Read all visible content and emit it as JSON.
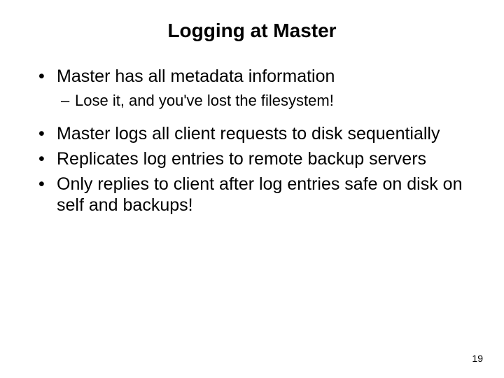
{
  "title": "Logging at Master",
  "bullets": [
    {
      "text": "Master has all metadata information",
      "subs": [
        "Lose it, and you've lost the filesystem!"
      ]
    },
    {
      "text": "Master logs all client requests to disk sequentially",
      "subs": []
    },
    {
      "text": "Replicates log entries to remote backup servers",
      "subs": []
    },
    {
      "text": "Only replies to client after log entries safe on disk on self and backups!",
      "subs": []
    }
  ],
  "page_number": "19"
}
